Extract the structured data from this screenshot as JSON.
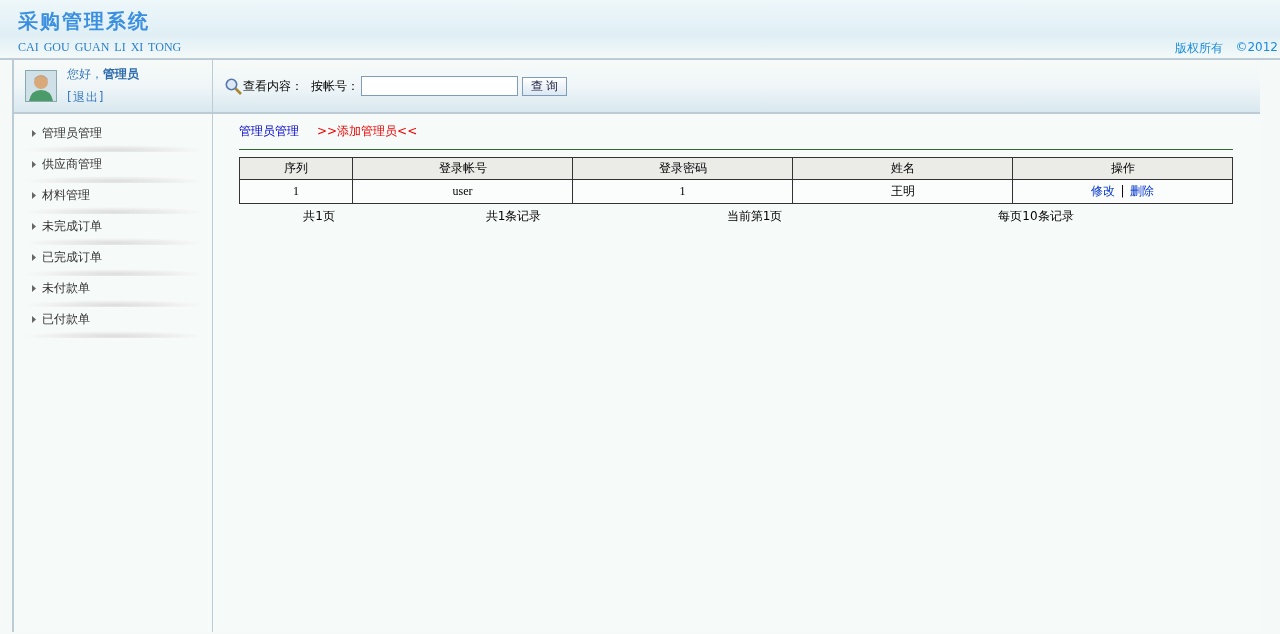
{
  "header": {
    "title": "采购管理系统",
    "subtitle": "CAI GOU GUAN LI XI TONG",
    "copyright": "版权所有",
    "year": "©2012"
  },
  "user": {
    "greeting": "您好，",
    "name": "管理员",
    "logout": "[退出]"
  },
  "search": {
    "label": "查看内容：",
    "field_label": "按帐号：",
    "button": "查 询"
  },
  "sidebar": {
    "items": [
      {
        "label": "管理员管理"
      },
      {
        "label": "供应商管理"
      },
      {
        "label": "材料管理"
      },
      {
        "label": "未完成订单"
      },
      {
        "label": "已完成订单"
      },
      {
        "label": "未付款单"
      },
      {
        "label": "已付款单"
      }
    ]
  },
  "breadcrumb": {
    "section": "管理员管理",
    "add_link": ">>添加管理员<<"
  },
  "table": {
    "columns": [
      "序列",
      "登录帐号",
      "登录密码",
      "姓名",
      "操作"
    ],
    "rows": [
      {
        "cells": [
          "1",
          "user",
          "1",
          "王明"
        ],
        "actions": [
          "修改",
          "删除"
        ],
        "separator": "|"
      }
    ]
  },
  "pager": [
    "共1页",
    "共1条记录",
    "当前第1页",
    "每页10条记录"
  ]
}
